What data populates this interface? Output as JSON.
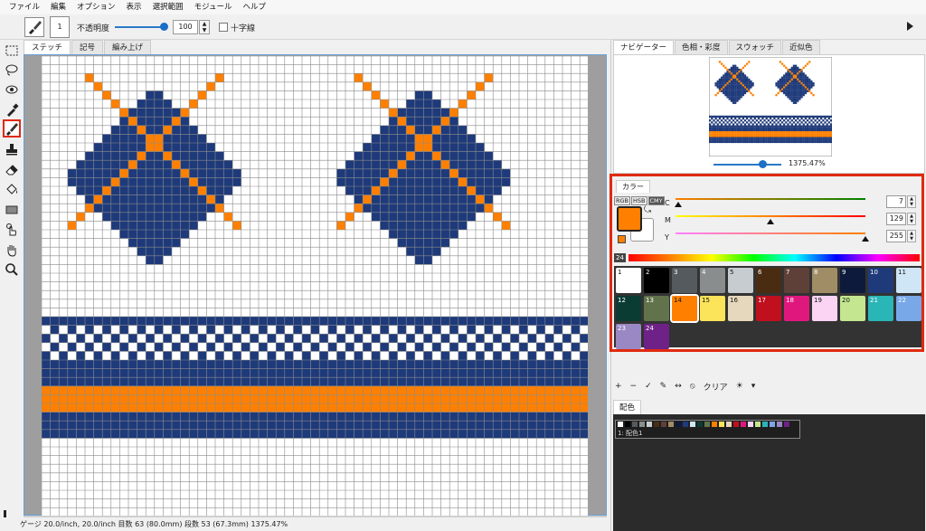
{
  "menu": [
    "ファイル",
    "編集",
    "オプション",
    "表示",
    "選択範囲",
    "モジュール",
    "ヘルプ"
  ],
  "toolbar": {
    "brush_size": "1",
    "opacity_label": "不透明度",
    "opacity_value": "100",
    "crosshair_label": "十字線"
  },
  "doc_tabs": [
    "ステッチ",
    "記号",
    "編み上げ"
  ],
  "status": "ゲージ 20.0/inch, 20.0/inch  目数 63 (80.0mm)  段数 53 (67.3mm)     1375.47%",
  "right_tabs": [
    "ナビゲーター",
    "色相・彩度",
    "スウォッチ",
    "近似色"
  ],
  "navigator": {
    "zoom": "1375.47%"
  },
  "color": {
    "tab": "カラー",
    "modes": [
      "RGB",
      "HSB",
      "CMY"
    ],
    "active_mode": "CMY",
    "fg": "#ff8000",
    "bg": "#ffffff",
    "sliders": [
      {
        "label": "C",
        "value": "7"
      },
      {
        "label": "M",
        "value": "129"
      },
      {
        "label": "Y",
        "value": "255"
      }
    ],
    "count": "24",
    "palette": [
      {
        "n": "1",
        "c": "#ffffff"
      },
      {
        "n": "2",
        "c": "#000000"
      },
      {
        "n": "3",
        "c": "#555a5e"
      },
      {
        "n": "4",
        "c": "#8a8d8e"
      },
      {
        "n": "5",
        "c": "#c6ccd0"
      },
      {
        "n": "6",
        "c": "#4a2c12"
      },
      {
        "n": "7",
        "c": "#5e4038"
      },
      {
        "n": "8",
        "c": "#a08d66"
      },
      {
        "n": "9",
        "c": "#0e1a3c"
      },
      {
        "n": "10",
        "c": "#1e3a7a"
      },
      {
        "n": "11",
        "c": "#cfe6f6"
      },
      {
        "n": "12",
        "c": "#0b3c34"
      },
      {
        "n": "13",
        "c": "#61734b"
      },
      {
        "n": "14",
        "c": "#ff8000"
      },
      {
        "n": "15",
        "c": "#fbe35a"
      },
      {
        "n": "16",
        "c": "#e6d8bc"
      },
      {
        "n": "17",
        "c": "#c0101e"
      },
      {
        "n": "18",
        "c": "#e0187e"
      },
      {
        "n": "19",
        "c": "#fbd4f4"
      },
      {
        "n": "20",
        "c": "#c4e690"
      },
      {
        "n": "21",
        "c": "#2ab6b6"
      },
      {
        "n": "22",
        "c": "#78a8e8"
      },
      {
        "n": "23",
        "c": "#9a88c4"
      },
      {
        "n": "24",
        "c": "#6e2288"
      }
    ],
    "selected": "14"
  },
  "panel_tools": [
    "+",
    "−",
    "✓",
    "✎",
    "↔",
    "⦸",
    "クリア",
    "☀",
    "▾"
  ],
  "haishoku": {
    "tab": "配色",
    "label": "1: 配色1"
  }
}
